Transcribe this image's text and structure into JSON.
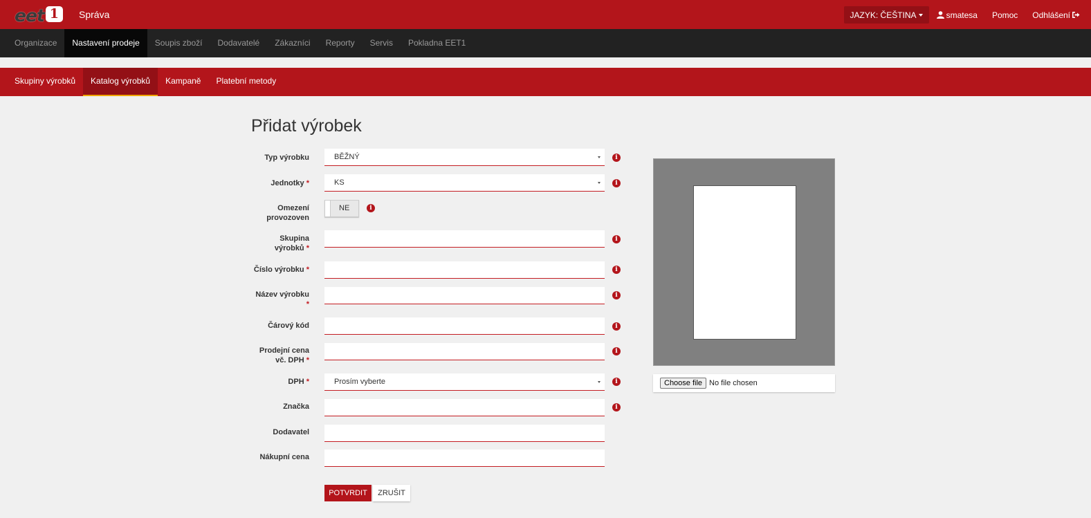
{
  "header": {
    "logo_text": "eet",
    "logo_badge": "1",
    "app_title": "Správa",
    "language_button": "JAZYK: ČEŠTINA",
    "user": "smatesa",
    "help": "Pomoc",
    "logout": "Odhlášení"
  },
  "main_nav": [
    "Organizace",
    "Nastavení prodeje",
    "Soupis zboží",
    "Dodavatelé",
    "Zákazníci",
    "Reporty",
    "Servis",
    "Pokladna EET1"
  ],
  "main_nav_active": "Nastavení prodeje",
  "sub_nav": [
    "Skupiny výrobků",
    "Katalog výrobků",
    "Kampaně",
    "Platební metody"
  ],
  "sub_nav_active": "Katalog výrobků",
  "form": {
    "title": "Přidat výrobek",
    "required_mark": "*",
    "info_glyph": "i",
    "fields": {
      "typ": {
        "label": "Typ výrobku",
        "value": "BĚŽNÝ"
      },
      "jednotky": {
        "label": "Jednotky",
        "value": "KS"
      },
      "omezeni": {
        "label_1": "Omezení",
        "label_2": "provozoven",
        "value": "NE"
      },
      "skupina": {
        "label_1": "Skupina",
        "label_2": "výrobků"
      },
      "cislo": {
        "label": "Číslo výrobku"
      },
      "nazev": {
        "label": "Název výrobku"
      },
      "carovy": {
        "label": "Čárový kód"
      },
      "cena": {
        "label_1": "Prodejní cena",
        "label_2": "vč. DPH"
      },
      "dph": {
        "label": "DPH",
        "value": "Prosím vyberte"
      },
      "znacka": {
        "label": "Značka"
      },
      "dodavatel": {
        "label": "Dodavatel"
      },
      "nakupni": {
        "label": "Nákupní cena"
      }
    },
    "submit": "POTVRDIT",
    "cancel": "ZRUŠIT"
  },
  "image_upload": {
    "choose_file": "Choose file",
    "no_file": "No file chosen"
  },
  "colors": {
    "brand_red": "#b3151b",
    "dark_red": "#931016",
    "dark_nav": "#222222",
    "active_underline": "#f0a500"
  }
}
